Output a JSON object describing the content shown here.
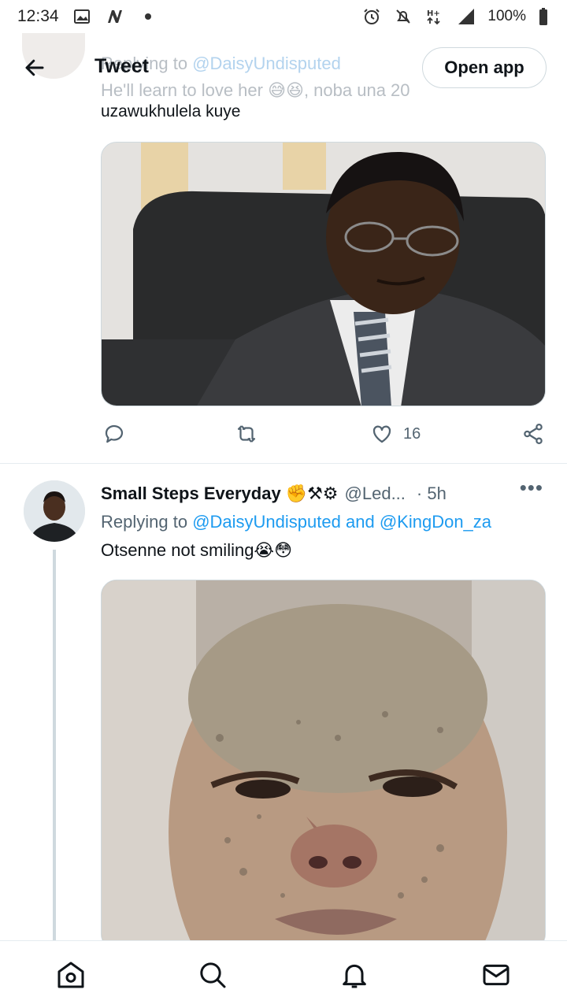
{
  "status_bar": {
    "time": "12:34",
    "battery": "100%",
    "icons": [
      "gallery-icon",
      "n-app-icon",
      "dot-icon",
      "alarm-icon",
      "mute-icon",
      "hplus-icon",
      "signal-icon",
      "battery-icon"
    ]
  },
  "header": {
    "title": "Tweet",
    "open_app": "Open app"
  },
  "previous_tweet": {
    "faded_line1": "Replying to",
    "faded_handle": "@DaisyUndisputed",
    "faded_line2": "He'll learn to love her 😅😆, noba una 20",
    "text": "uzawukhulela kuye",
    "likes": "16"
  },
  "tweet": {
    "name": "Small Steps Everyday",
    "badges": "✊⚒⚙",
    "handle": "@Led...",
    "time": "· 5h",
    "more": "•••",
    "replying_prefix": "Replying to",
    "reply_to_1": "@DaisyUndisputed",
    "reply_and": "and",
    "reply_to_2": "@KingDon_za",
    "text": "Otsenne not smiling😭😳"
  },
  "nav": [
    "home-icon",
    "search-icon",
    "notifications-icon",
    "messages-icon"
  ],
  "colors": {
    "accent": "#1d9bf0",
    "text_primary": "#0f1419",
    "text_secondary": "#536471",
    "border": "#cfd9de"
  }
}
